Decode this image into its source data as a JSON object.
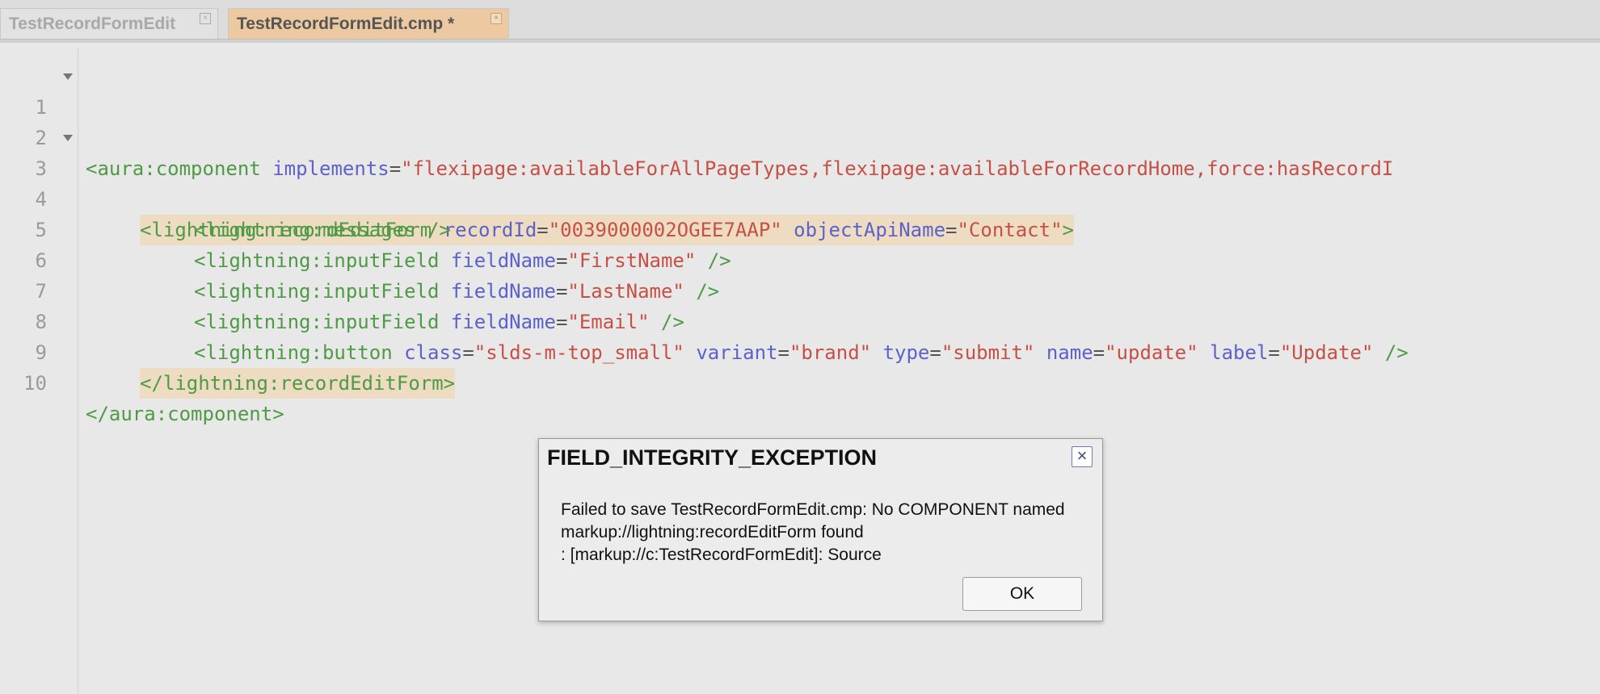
{
  "tabs": [
    {
      "label": "TestRecordFormEdit",
      "close": "×"
    },
    {
      "label": "TestRecordFormEdit.cmp *",
      "close": "×"
    }
  ],
  "editor": {
    "line_numbers": [
      "1",
      "2",
      "3",
      "4",
      "5",
      "6",
      "7",
      "8",
      "9",
      "10"
    ],
    "lines": {
      "l1": {
        "tag_open": "<aura:component",
        "attr1": "implements",
        "eq": "=",
        "val1": "\"flexipage:availableForAllPageTypes,flexipage:availableForRecordHome,force:hasRecordI"
      },
      "l3": {
        "tag_open": "<lightning:recordEditForm",
        "attr1": "recordId",
        "val1": "\"0039000002OGEE7AAP\"",
        "attr2": "objectApiName",
        "val2": "\"Contact\"",
        "tag_close": ">"
      },
      "l4": {
        "tag": "<lightning:messages />"
      },
      "l5": {
        "tag_open": "<lightning:inputField",
        "attr1": "fieldName",
        "val1": "\"FirstName\"",
        "tag_close": " />"
      },
      "l6": {
        "tag_open": "<lightning:inputField",
        "attr1": "fieldName",
        "val1": "\"LastName\"",
        "tag_close": " />"
      },
      "l7": {
        "tag_open": "<lightning:inputField",
        "attr1": "fieldName",
        "val1": "\"Email\"",
        "tag_close": " />"
      },
      "l8": {
        "tag_open": "<lightning:button",
        "attr1": "class",
        "val1": "\"slds-m-top_small\"",
        "attr2": "variant",
        "val2": "\"brand\"",
        "attr3": "type",
        "val3": "\"submit\"",
        "attr4": "name",
        "val4": "\"update\"",
        "attr5": "label",
        "val5": "\"Update\"",
        "tag_close": " />"
      },
      "l9": {
        "tag": "</lightning:recordEditForm>"
      },
      "l10": {
        "tag": "</aura:component>"
      }
    }
  },
  "dialog": {
    "title": "FIELD_INTEGRITY_EXCEPTION",
    "message_line1": "Failed to save TestRecordFormEdit.cmp: No COMPONENT named markup://lightning:recordEditForm found",
    "message_line2": ": [markup://c:TestRecordFormEdit]: Source",
    "ok_label": "OK",
    "close": "×"
  }
}
